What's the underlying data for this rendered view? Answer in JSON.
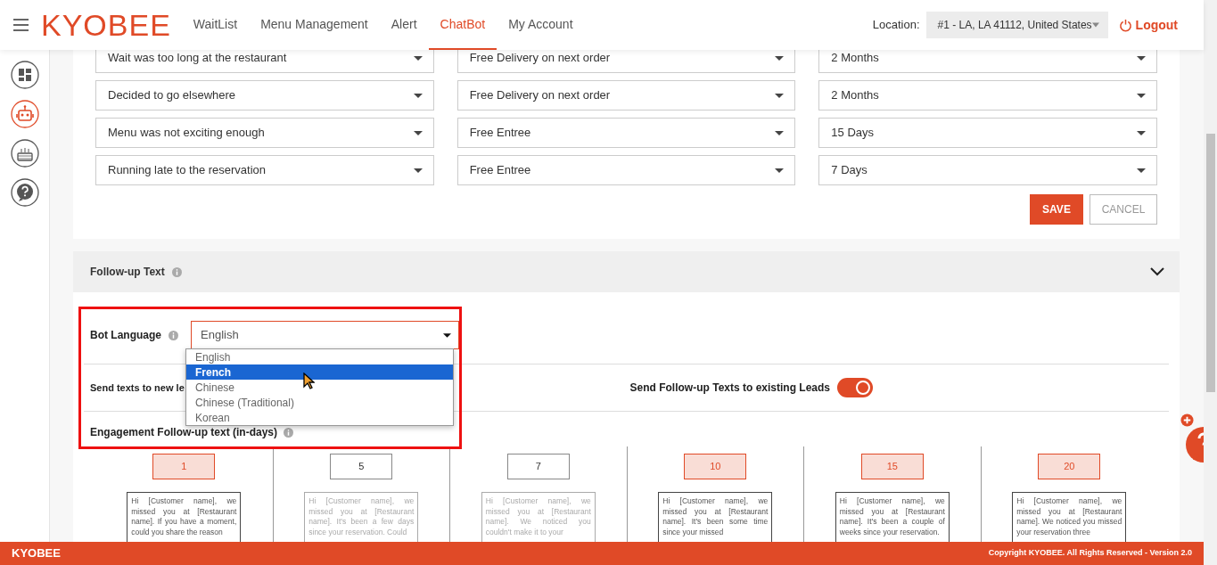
{
  "header": {
    "logo": "KYOBEE",
    "nav": [
      {
        "label": "WaitList",
        "selected": false
      },
      {
        "label": "Menu Management",
        "selected": false
      },
      {
        "label": "Alert",
        "selected": false
      },
      {
        "label": "ChatBot",
        "selected": true
      },
      {
        "label": "My Account",
        "selected": false
      }
    ],
    "location_label": "Location:",
    "location_value": "#1 - LA, LA 41112, United States",
    "logout": "Logout"
  },
  "sidebar": {
    "items": [
      {
        "kind": "dashboard",
        "selected": false
      },
      {
        "kind": "robot",
        "selected": true
      },
      {
        "kind": "cake",
        "selected": false
      },
      {
        "kind": "help",
        "selected": false
      }
    ]
  },
  "offers": {
    "rows": [
      {
        "reason": "Wait was too long at the restaurant",
        "offer": "Free Delivery on next order",
        "validity": "2 Months"
      },
      {
        "reason": "Decided to go elsewhere",
        "offer": "Free Delivery on next order",
        "validity": "2 Months"
      },
      {
        "reason": "Menu was not exciting enough",
        "offer": "Free Entree",
        "validity": "15 Days"
      },
      {
        "reason": "Running late to the reservation",
        "offer": "Free Entree",
        "validity": "7 Days"
      }
    ],
    "save": "SAVE",
    "cancel": "CANCEL"
  },
  "follow_up": {
    "title": "Follow-up Text",
    "expanded": true,
    "bot_language": {
      "label": "Bot Language",
      "value": "English",
      "options": [
        {
          "label": "English",
          "highlighted": false
        },
        {
          "label": "French",
          "highlighted": true
        },
        {
          "label": "Chinese",
          "highlighted": false
        },
        {
          "label": "Chinese (Traditional)",
          "highlighted": false
        },
        {
          "label": "Korean",
          "highlighted": false
        }
      ]
    },
    "new_leads_label": "Send texts to new le",
    "existing_leads": {
      "label": "Send Follow-up Texts to existing Leads",
      "on": true
    },
    "engagement_label": "Engagement Follow-up text (in-days)",
    "days": [
      {
        "day": "1",
        "selected": true,
        "message": "Hi [Customer name], we missed you at [Restaurant name]. If you have a moment, could you share the reason"
      },
      {
        "day": "5",
        "selected": false,
        "message": "Hi [Customer name], we missed you at [Restaurant name]. It's been a few days since your reservation. Could"
      },
      {
        "day": "7",
        "selected": false,
        "message": "Hi [Customer name], we missed you at [Restaurant name]. We noticed you couldn't make it to your"
      },
      {
        "day": "10",
        "selected": true,
        "message": "Hi [Customer name], we missed you at [Restaurant name]. It's been some time since your missed"
      },
      {
        "day": "15",
        "selected": true,
        "message": "Hi [Customer name], we missed you at [Restaurant name]. It's been a couple of weeks since your reservation."
      },
      {
        "day": "20",
        "selected": true,
        "message": "Hi [Customer name], we missed you at [Restaurant name]. We noticed you missed your reservation three"
      }
    ]
  },
  "footer": {
    "brand": "KYOBEE",
    "copyright": "Copyright KYOBEE. All Rights Reserved - Version 2.0"
  }
}
